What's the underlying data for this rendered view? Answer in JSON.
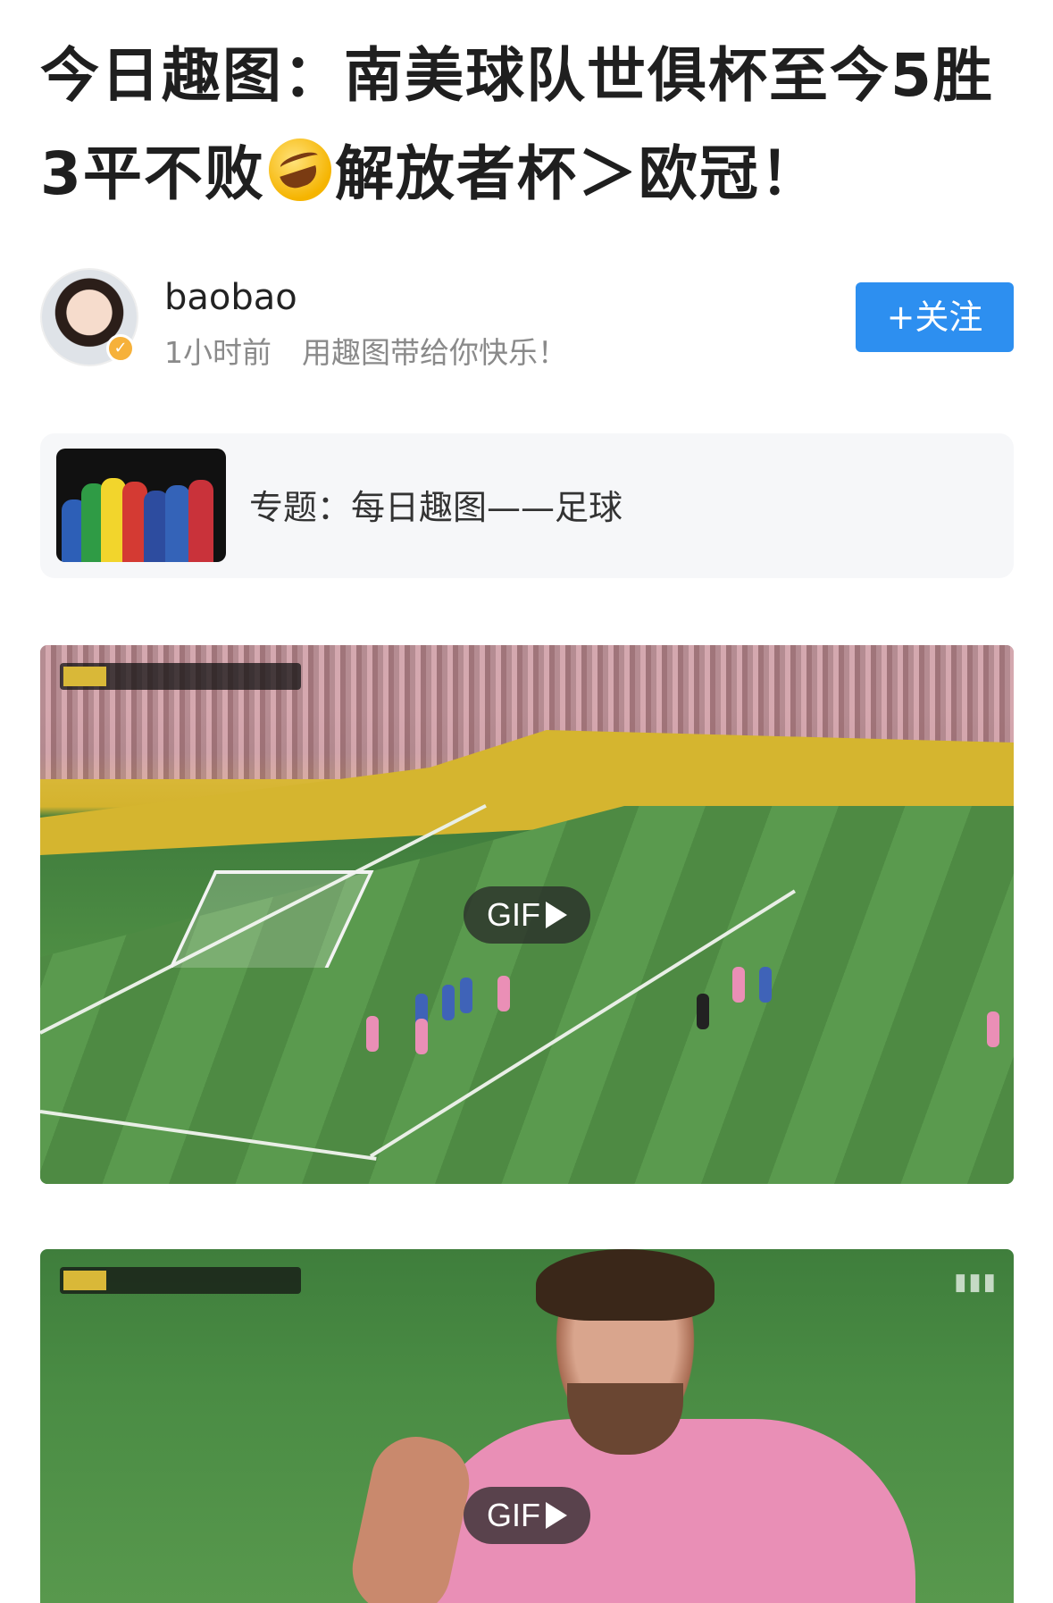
{
  "article": {
    "title": "今日趣图：南美球队世俱杯至今5胜3平不败",
    "title_emoji": "🤣",
    "title_suffix": "解放者杯＞欧冠！"
  },
  "author": {
    "name": "baobao",
    "time": "1小时前",
    "bio": "用趣图带给你快乐！",
    "follow_label": "+关注",
    "avatar_icon": "girl-avatar-icon",
    "verified_icon": "verified-check-icon"
  },
  "topic": {
    "label": "专题：每日趣图——足球"
  },
  "media": [
    {
      "badge": "GIF"
    },
    {
      "badge": "GIF"
    }
  ],
  "colors": {
    "accent": "#2d8ff0",
    "verified": "#f6b13a",
    "meta_text": "#8a8a8a"
  }
}
